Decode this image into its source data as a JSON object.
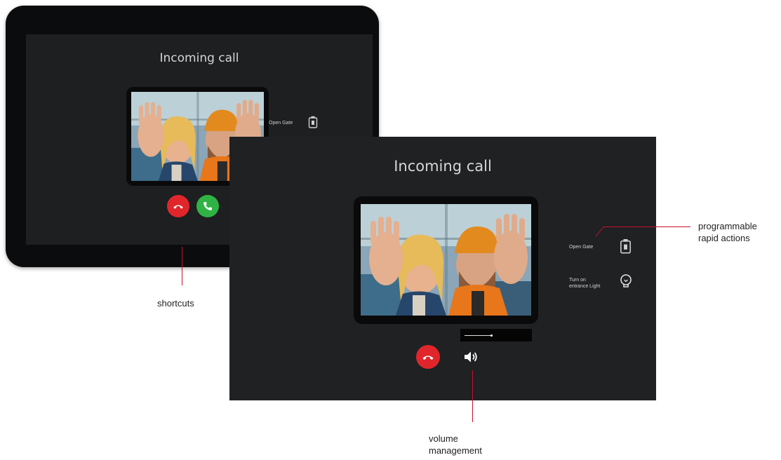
{
  "back_device": {
    "title": "Incoming call",
    "rapid_action_label": "Open Gate",
    "buttons": [
      {
        "name": "hang-up",
        "icon": "phone-hangup-icon",
        "color": "#e0262b"
      },
      {
        "name": "answer",
        "icon": "phone-answer-icon",
        "color": "#2fb344"
      }
    ]
  },
  "front_screen": {
    "title": "Incoming call",
    "rapid_actions": [
      {
        "label": "Open Gate",
        "icon": "gate-icon"
      },
      {
        "label": "Turn on\nentrance Light",
        "icon": "lightbulb-icon"
      }
    ],
    "volume": {
      "level": 0.42
    },
    "buttons": [
      {
        "name": "hang-up",
        "icon": "phone-hangup-icon",
        "color": "#e0262b"
      },
      {
        "name": "volume",
        "icon": "speaker-icon",
        "color": "#ffffff"
      }
    ]
  },
  "callouts": {
    "shortcuts": "shortcuts",
    "rapid_actions": "programmable\nrapid actions",
    "volume": "volume\nmanagement"
  },
  "colors": {
    "accent_red": "#c8102e",
    "screen_bg": "#1f2123",
    "device_frame": "#0b0c0e"
  }
}
